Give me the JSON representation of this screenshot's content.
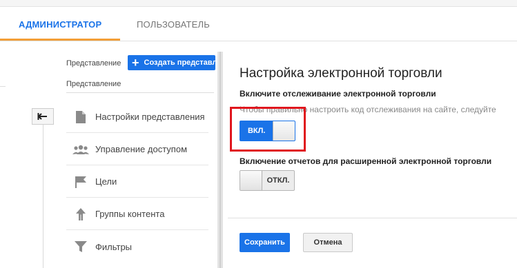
{
  "tabs": {
    "admin": "АДМИНИСТРАТОР",
    "user": "ПОЛЬЗОВАТЕЛЬ",
    "active": "admin",
    "underline_color": "#f29e38"
  },
  "sidebar": {
    "view_label": "Представление",
    "create_button": "Создать представле",
    "view_selector_label": "Представление",
    "back_icon": "back-arrow-icon",
    "items": [
      {
        "label": "Настройки представления",
        "icon": "document-icon"
      },
      {
        "label": "Управление доступом",
        "icon": "people-icon"
      },
      {
        "label": "Цели",
        "icon": "flag-icon"
      },
      {
        "label": "Группы контента",
        "icon": "content-groups-icon"
      },
      {
        "label": "Фильтры",
        "icon": "filter-icon"
      }
    ]
  },
  "panel": {
    "title": "Настройка электронной торговли",
    "ecommerce": {
      "heading": "Включите отслеживание электронной торговли",
      "hint": "Чтобы правильно настроить код отслеживания на сайте, следуйте",
      "toggle_label": "ВКЛ.",
      "toggle_state": "on"
    },
    "enhanced": {
      "heading": "Включение отчетов для расширенной электронной торговли",
      "toggle_label": "ОТКЛ.",
      "toggle_state": "off"
    },
    "save_button": "Сохранить",
    "cancel_button": "Отмена"
  },
  "colors": {
    "accent": "#1a73e8",
    "highlight": "#e0161d"
  }
}
